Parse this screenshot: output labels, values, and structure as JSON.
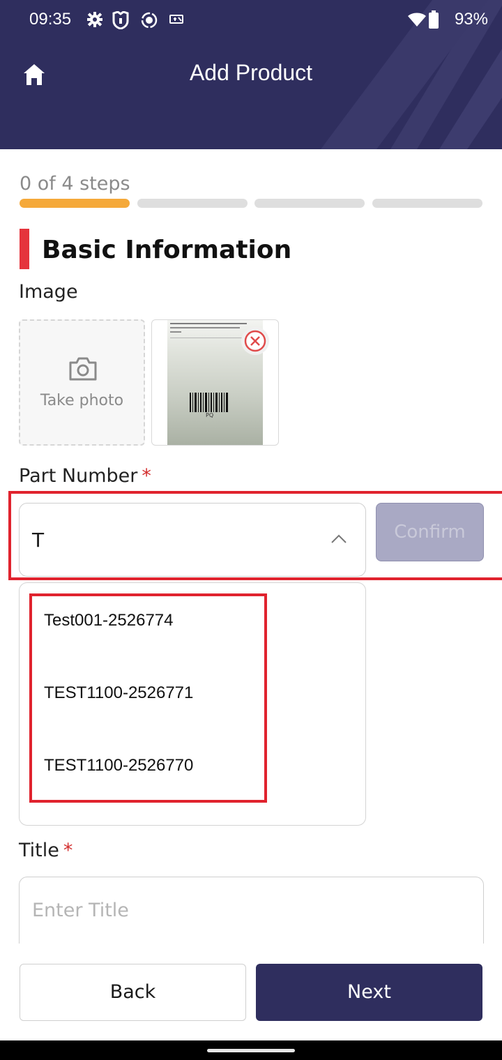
{
  "status_bar": {
    "time": "09:35",
    "battery": "93%",
    "icons": [
      "settings-icon",
      "shield-icon",
      "record-icon",
      "cast-icon",
      "wifi-icon",
      "battery-icon"
    ]
  },
  "header": {
    "title": "Add Product",
    "home_icon": "home-icon",
    "background_color": "#2f2e5e"
  },
  "progress": {
    "text": "0 of 4 steps",
    "total_steps": 4,
    "active_color": "#f5a93a",
    "inactive_color": "#dedede"
  },
  "section": {
    "title": "Basic Information",
    "accent_color": "#e5343c"
  },
  "image_field": {
    "label": "Image",
    "take_photo_label": "Take photo",
    "thumbnail_caption": "PQ"
  },
  "part_number": {
    "label": "Part Number",
    "required_mark": "*",
    "value": "T",
    "confirm_label": "Confirm",
    "options": [
      "Test001-2526774",
      "TEST1100-2526771",
      "TEST1100-2526770"
    ]
  },
  "title_field": {
    "label": "Title",
    "required_mark": "*",
    "placeholder": "Enter Title"
  },
  "footer": {
    "back_label": "Back",
    "next_label": "Next"
  }
}
